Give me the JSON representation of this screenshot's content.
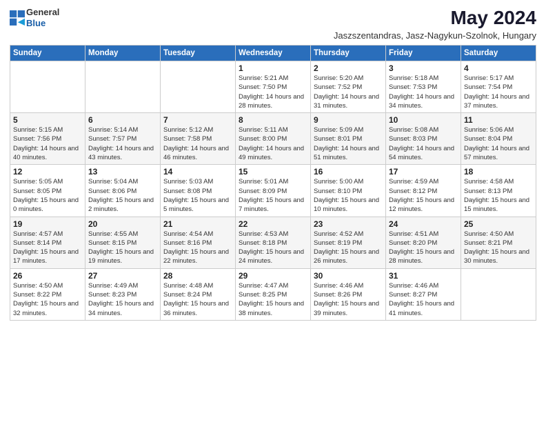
{
  "logo": {
    "general": "General",
    "blue": "Blue"
  },
  "header": {
    "month_year": "May 2024",
    "location": "Jaszszentandras, Jasz-Nagykun-Szolnok, Hungary"
  },
  "weekdays": [
    "Sunday",
    "Monday",
    "Tuesday",
    "Wednesday",
    "Thursday",
    "Friday",
    "Saturday"
  ],
  "weeks": [
    [
      {
        "day": "",
        "sunrise": "",
        "sunset": "",
        "daylight": ""
      },
      {
        "day": "",
        "sunrise": "",
        "sunset": "",
        "daylight": ""
      },
      {
        "day": "",
        "sunrise": "",
        "sunset": "",
        "daylight": ""
      },
      {
        "day": "1",
        "sunrise": "Sunrise: 5:21 AM",
        "sunset": "Sunset: 7:50 PM",
        "daylight": "Daylight: 14 hours and 28 minutes."
      },
      {
        "day": "2",
        "sunrise": "Sunrise: 5:20 AM",
        "sunset": "Sunset: 7:52 PM",
        "daylight": "Daylight: 14 hours and 31 minutes."
      },
      {
        "day": "3",
        "sunrise": "Sunrise: 5:18 AM",
        "sunset": "Sunset: 7:53 PM",
        "daylight": "Daylight: 14 hours and 34 minutes."
      },
      {
        "day": "4",
        "sunrise": "Sunrise: 5:17 AM",
        "sunset": "Sunset: 7:54 PM",
        "daylight": "Daylight: 14 hours and 37 minutes."
      }
    ],
    [
      {
        "day": "5",
        "sunrise": "Sunrise: 5:15 AM",
        "sunset": "Sunset: 7:56 PM",
        "daylight": "Daylight: 14 hours and 40 minutes."
      },
      {
        "day": "6",
        "sunrise": "Sunrise: 5:14 AM",
        "sunset": "Sunset: 7:57 PM",
        "daylight": "Daylight: 14 hours and 43 minutes."
      },
      {
        "day": "7",
        "sunrise": "Sunrise: 5:12 AM",
        "sunset": "Sunset: 7:58 PM",
        "daylight": "Daylight: 14 hours and 46 minutes."
      },
      {
        "day": "8",
        "sunrise": "Sunrise: 5:11 AM",
        "sunset": "Sunset: 8:00 PM",
        "daylight": "Daylight: 14 hours and 49 minutes."
      },
      {
        "day": "9",
        "sunrise": "Sunrise: 5:09 AM",
        "sunset": "Sunset: 8:01 PM",
        "daylight": "Daylight: 14 hours and 51 minutes."
      },
      {
        "day": "10",
        "sunrise": "Sunrise: 5:08 AM",
        "sunset": "Sunset: 8:03 PM",
        "daylight": "Daylight: 14 hours and 54 minutes."
      },
      {
        "day": "11",
        "sunrise": "Sunrise: 5:06 AM",
        "sunset": "Sunset: 8:04 PM",
        "daylight": "Daylight: 14 hours and 57 minutes."
      }
    ],
    [
      {
        "day": "12",
        "sunrise": "Sunrise: 5:05 AM",
        "sunset": "Sunset: 8:05 PM",
        "daylight": "Daylight: 15 hours and 0 minutes."
      },
      {
        "day": "13",
        "sunrise": "Sunrise: 5:04 AM",
        "sunset": "Sunset: 8:06 PM",
        "daylight": "Daylight: 15 hours and 2 minutes."
      },
      {
        "day": "14",
        "sunrise": "Sunrise: 5:03 AM",
        "sunset": "Sunset: 8:08 PM",
        "daylight": "Daylight: 15 hours and 5 minutes."
      },
      {
        "day": "15",
        "sunrise": "Sunrise: 5:01 AM",
        "sunset": "Sunset: 8:09 PM",
        "daylight": "Daylight: 15 hours and 7 minutes."
      },
      {
        "day": "16",
        "sunrise": "Sunrise: 5:00 AM",
        "sunset": "Sunset: 8:10 PM",
        "daylight": "Daylight: 15 hours and 10 minutes."
      },
      {
        "day": "17",
        "sunrise": "Sunrise: 4:59 AM",
        "sunset": "Sunset: 8:12 PM",
        "daylight": "Daylight: 15 hours and 12 minutes."
      },
      {
        "day": "18",
        "sunrise": "Sunrise: 4:58 AM",
        "sunset": "Sunset: 8:13 PM",
        "daylight": "Daylight: 15 hours and 15 minutes."
      }
    ],
    [
      {
        "day": "19",
        "sunrise": "Sunrise: 4:57 AM",
        "sunset": "Sunset: 8:14 PM",
        "daylight": "Daylight: 15 hours and 17 minutes."
      },
      {
        "day": "20",
        "sunrise": "Sunrise: 4:55 AM",
        "sunset": "Sunset: 8:15 PM",
        "daylight": "Daylight: 15 hours and 19 minutes."
      },
      {
        "day": "21",
        "sunrise": "Sunrise: 4:54 AM",
        "sunset": "Sunset: 8:16 PM",
        "daylight": "Daylight: 15 hours and 22 minutes."
      },
      {
        "day": "22",
        "sunrise": "Sunrise: 4:53 AM",
        "sunset": "Sunset: 8:18 PM",
        "daylight": "Daylight: 15 hours and 24 minutes."
      },
      {
        "day": "23",
        "sunrise": "Sunrise: 4:52 AM",
        "sunset": "Sunset: 8:19 PM",
        "daylight": "Daylight: 15 hours and 26 minutes."
      },
      {
        "day": "24",
        "sunrise": "Sunrise: 4:51 AM",
        "sunset": "Sunset: 8:20 PM",
        "daylight": "Daylight: 15 hours and 28 minutes."
      },
      {
        "day": "25",
        "sunrise": "Sunrise: 4:50 AM",
        "sunset": "Sunset: 8:21 PM",
        "daylight": "Daylight: 15 hours and 30 minutes."
      }
    ],
    [
      {
        "day": "26",
        "sunrise": "Sunrise: 4:50 AM",
        "sunset": "Sunset: 8:22 PM",
        "daylight": "Daylight: 15 hours and 32 minutes."
      },
      {
        "day": "27",
        "sunrise": "Sunrise: 4:49 AM",
        "sunset": "Sunset: 8:23 PM",
        "daylight": "Daylight: 15 hours and 34 minutes."
      },
      {
        "day": "28",
        "sunrise": "Sunrise: 4:48 AM",
        "sunset": "Sunset: 8:24 PM",
        "daylight": "Daylight: 15 hours and 36 minutes."
      },
      {
        "day": "29",
        "sunrise": "Sunrise: 4:47 AM",
        "sunset": "Sunset: 8:25 PM",
        "daylight": "Daylight: 15 hours and 38 minutes."
      },
      {
        "day": "30",
        "sunrise": "Sunrise: 4:46 AM",
        "sunset": "Sunset: 8:26 PM",
        "daylight": "Daylight: 15 hours and 39 minutes."
      },
      {
        "day": "31",
        "sunrise": "Sunrise: 4:46 AM",
        "sunset": "Sunset: 8:27 PM",
        "daylight": "Daylight: 15 hours and 41 minutes."
      },
      {
        "day": "",
        "sunrise": "",
        "sunset": "",
        "daylight": ""
      }
    ]
  ]
}
